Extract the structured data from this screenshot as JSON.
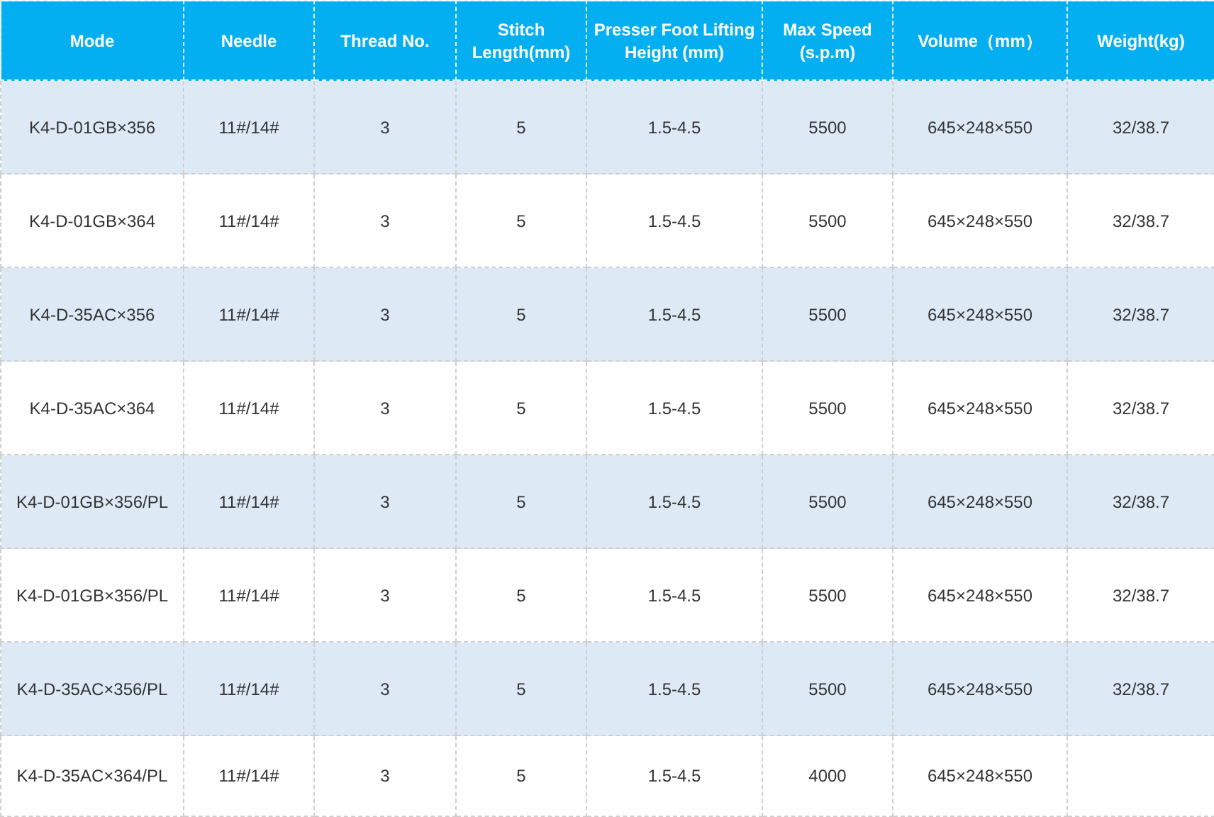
{
  "table": {
    "columns": [
      "Mode",
      "Needle",
      "Thread No.",
      "Stitch Length(mm)",
      "Presser Foot Lifting Height (mm)",
      "Max Speed (s.p.m)",
      "Volume（mm）",
      "Weight(kg)"
    ],
    "rows": [
      [
        "K4-D-01GB×356",
        "11#/14#",
        "3",
        "5",
        "1.5-4.5",
        "5500",
        "645×248×550",
        "32/38.7"
      ],
      [
        "K4-D-01GB×364",
        "11#/14#",
        "3",
        "5",
        "1.5-4.5",
        "5500",
        "645×248×550",
        "32/38.7"
      ],
      [
        "K4-D-35AC×356",
        "11#/14#",
        "3",
        "5",
        "1.5-4.5",
        "5500",
        "645×248×550",
        "32/38.7"
      ],
      [
        "K4-D-35AC×364",
        "11#/14#",
        "3",
        "5",
        "1.5-4.5",
        "5500",
        "645×248×550",
        "32/38.7"
      ],
      [
        "K4-D-01GB×356/PL",
        "11#/14#",
        "3",
        "5",
        "1.5-4.5",
        "5500",
        "645×248×550",
        "32/38.7"
      ],
      [
        "K4-D-01GB×356/PL",
        "11#/14#",
        "3",
        "5",
        "1.5-4.5",
        "5500",
        "645×248×550",
        "32/38.7"
      ],
      [
        "K4-D-35AC×356/PL",
        "11#/14#",
        "3",
        "5",
        "1.5-4.5",
        "5500",
        "645×248×550",
        "32/38.7"
      ],
      [
        "K4-D-35AC×364/PL",
        "11#/14#",
        "3",
        "5",
        "1.5-4.5",
        "4000",
        "645×248×550"
      ]
    ]
  }
}
